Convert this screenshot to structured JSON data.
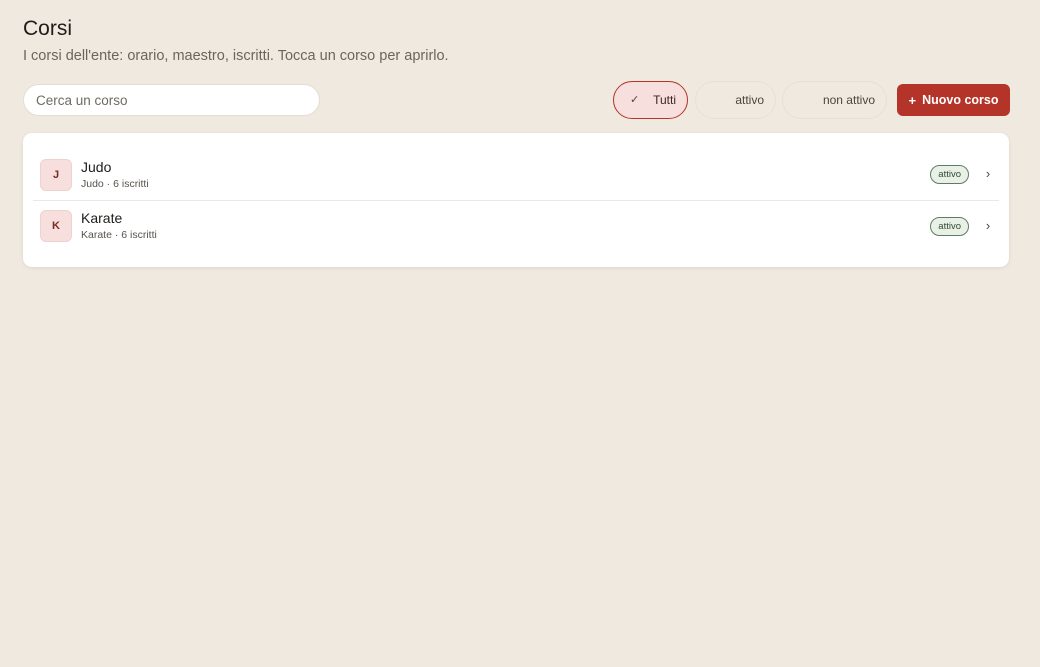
{
  "header": {
    "title": "Corsi",
    "subtitle": "I corsi dell'ente: orario, maestro, iscritti. Tocca un corso per aprirlo."
  },
  "search": {
    "placeholder": "Cerca un corso",
    "value": ""
  },
  "filters": {
    "selected": "Tutti",
    "chips": [
      {
        "label": "Tutti",
        "selected": true,
        "icon": "check-icon"
      },
      {
        "label": "attivo",
        "selected": false
      },
      {
        "label": "non attivo",
        "selected": false
      }
    ]
  },
  "actions": {
    "new_label": "Nuovo corso",
    "new_icon_glyph": "+"
  },
  "courses": [
    {
      "initial": "J",
      "name": "Judo",
      "meta": "Judo · 6 iscritti",
      "status": "attivo"
    },
    {
      "initial": "K",
      "name": "Karate",
      "meta": "Karate · 6 iscritti",
      "status": "attivo"
    }
  ],
  "icons": {
    "check": "✓",
    "chevron": "›"
  },
  "colors": {
    "background": "#efe9df",
    "accent": "#b5342a",
    "selected_chip_bg": "#f6dfdc",
    "status_active_border": "#5e7c64",
    "status_active_bg": "#e9f1e6"
  }
}
